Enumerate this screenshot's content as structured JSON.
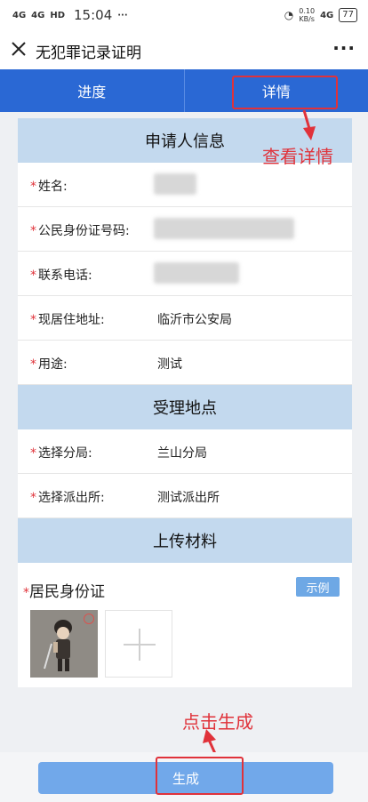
{
  "status_bar": {
    "signal1": "4G",
    "signal2": "4G",
    "hd": "HD",
    "time": "15:04",
    "net_speed": "0.10",
    "net_unit": "KB/s",
    "signal3": "4G",
    "battery": "77",
    "dots": "···"
  },
  "title_bar": {
    "title": "无犯罪记录证明",
    "close_icon": "close-icon",
    "more_icon": "more-icon"
  },
  "tabs": [
    {
      "label": "进度"
    },
    {
      "label": "详情"
    }
  ],
  "applicant_section": {
    "heading": "申请人信息",
    "fields": [
      {
        "label": "姓名:",
        "value": ""
      },
      {
        "label": "公民身份证号码:",
        "value": ""
      },
      {
        "label": "联系电话:",
        "value": ""
      },
      {
        "label": "现居住地址:",
        "value": "临沂市公安局"
      },
      {
        "label": "用途:",
        "value": "测试"
      }
    ]
  },
  "location_section": {
    "heading": "受理地点",
    "fields": [
      {
        "label": "选择分局:",
        "value": "兰山分局"
      },
      {
        "label": "选择派出所:",
        "value": "测试派出所"
      }
    ]
  },
  "upload_section": {
    "heading": "上传材料",
    "label": "居民身份证",
    "example_button": "示例"
  },
  "annotations": {
    "view_details": "查看详情",
    "click_generate": "点击生成"
  },
  "required_mark": "*",
  "bottom": {
    "generate_button": "生成"
  },
  "colors": {
    "tab_bar": "#2a68d4",
    "section_head": "#c3d9ee",
    "button": "#71a8ea",
    "annotation": "#e0323a"
  }
}
